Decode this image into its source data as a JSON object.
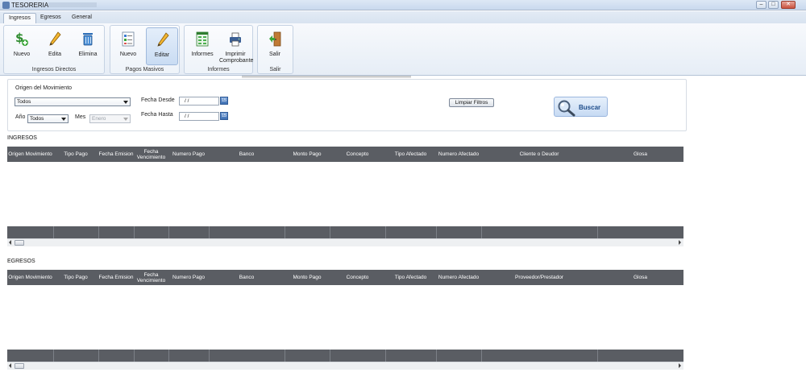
{
  "window": {
    "title": "TESORERIA"
  },
  "tabs": [
    {
      "label": "Ingresos",
      "active": true
    },
    {
      "label": "Egresos",
      "active": false
    },
    {
      "label": "General",
      "active": false
    }
  ],
  "ribbon": {
    "groups": [
      {
        "label": "Ingresos Directos",
        "buttons": [
          {
            "label": "Nuevo",
            "icon": "money-add-icon"
          },
          {
            "label": "Edita",
            "icon": "pencil-icon"
          },
          {
            "label": "Elimina",
            "icon": "trash-icon"
          }
        ]
      },
      {
        "label": "Pagos Masivos",
        "buttons": [
          {
            "label": "Nuevo",
            "icon": "checklist-icon"
          },
          {
            "label": "Editar",
            "icon": "pencil-icon",
            "pressed": true
          }
        ]
      },
      {
        "label": "Informes",
        "buttons": [
          {
            "label": "Informes",
            "icon": "spreadsheet-icon"
          },
          {
            "label": "Imprimir Comprobante",
            "icon": "printer-icon"
          }
        ]
      },
      {
        "label": "Salir",
        "buttons": [
          {
            "label": "Salir",
            "icon": "exit-door-icon"
          }
        ]
      }
    ]
  },
  "filters": {
    "origen_label": "Origen del Movimiento",
    "origen_value": "Todos",
    "anio_label": "Año",
    "anio_value": "Todos",
    "mes_label": "Mes",
    "mes_value": "Enero",
    "fecha_desde_label": "Fecha Desde",
    "fecha_desde_value": "/ /",
    "fecha_hasta_label": "Fecha Hasta",
    "fecha_hasta_value": "/ /",
    "limpiar_label": "Limpiar Filtros",
    "buscar_label": "Buscar"
  },
  "ingresos": {
    "title": "INGRESOS",
    "columns": [
      "Origen Movimiento",
      "Tipo Pago",
      "Fecha Emision",
      "Fecha Vencimiento",
      "Numero Pago",
      "Banco",
      "Monto Pago",
      "Concepto",
      "Tipo Afectado",
      "Numero Afectado",
      "Cliente o Deudor",
      "Glosa"
    ]
  },
  "egresos": {
    "title": "EGRESOS",
    "columns": [
      "Origen Movimiento",
      "Tipo Pago",
      "Fecha Emision",
      "Fecha Vencimiento",
      "Numero Pago",
      "Banco",
      "Monto Pago",
      "Concepto",
      "Tipo Afectado",
      "Numero Afectado",
      "Proveedor/Prestador",
      "Glosa"
    ]
  },
  "colors": {
    "grid_header": "#5a5d63",
    "ribbon_bg": "#e6edf6",
    "buscar_text": "#1f4d8a"
  }
}
